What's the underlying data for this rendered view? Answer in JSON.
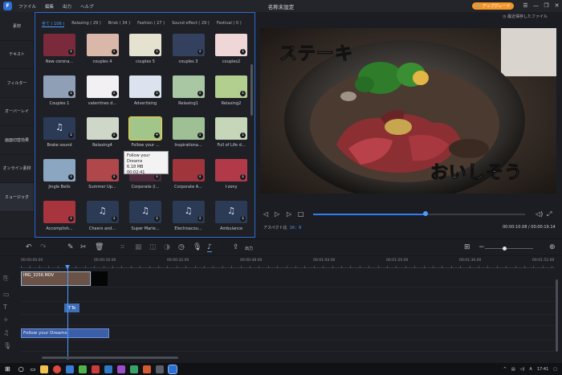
{
  "titlebar": {
    "menu": [
      "ファイル",
      "編集",
      "出力",
      "ヘルプ"
    ],
    "document_title": "名称未設定",
    "upgrade_label": "アップグレード"
  },
  "sidebar": {
    "items": [
      {
        "label": "素材"
      },
      {
        "label": "テキスト"
      },
      {
        "label": "フィルター"
      },
      {
        "label": "オーバーレイ"
      },
      {
        "label": "画面切替効果"
      },
      {
        "label": "オンライン素材"
      },
      {
        "label": "ミュージック"
      }
    ],
    "active_index": 6
  },
  "library": {
    "tabs": [
      {
        "label": "全て ( 106 )"
      },
      {
        "label": "Relaxing ( 29 )"
      },
      {
        "label": "Brisk ( 34 )"
      },
      {
        "label": "Fashion ( 27 )"
      },
      {
        "label": "Sound effect ( 29 )"
      },
      {
        "label": "Festival ( 0 )"
      }
    ],
    "items": [
      {
        "label": "New corona...",
        "color": "#7a2a3a",
        "icon": "image"
      },
      {
        "label": "couples 4",
        "color": "#d9b8a9",
        "icon": "image"
      },
      {
        "label": "couples 5",
        "color": "#e6e2d0",
        "icon": "image"
      },
      {
        "label": "couples 3",
        "color": "#33415e",
        "icon": "image"
      },
      {
        "label": "couples2",
        "color": "#f0d7d7",
        "icon": "image"
      },
      {
        "label": "Couples 1",
        "color": "#8f9fb6",
        "icon": "image"
      },
      {
        "label": "valentines d...",
        "color": "#f3f0f4",
        "icon": "image"
      },
      {
        "label": "Advertising",
        "color": "#dde3ee",
        "icon": "image"
      },
      {
        "label": "Relaxing1",
        "color": "#a9c7a3",
        "icon": "image"
      },
      {
        "label": "Relaxing2",
        "color": "#b3cf8f",
        "icon": "image"
      },
      {
        "label": "Brake sound",
        "color": "#2b3a55",
        "icon": "music-note"
      },
      {
        "label": "Relaxing4",
        "color": "#cfd8c8",
        "icon": "image"
      },
      {
        "label": "Follow your ...",
        "color": "#a2c58a",
        "icon": "image"
      },
      {
        "label": "Inspirationa...",
        "color": "#9fbf94",
        "icon": "image"
      },
      {
        "label": "Full of Life d...",
        "color": "#c6d6b9",
        "icon": "image"
      },
      {
        "label": "Jingle Bells",
        "color": "#8aa6c0",
        "icon": "image"
      },
      {
        "label": "Summer Up...",
        "color": "#b0474b",
        "icon": "image"
      },
      {
        "label": "Corporate (l...",
        "color": "#4e2a3e",
        "icon": "image"
      },
      {
        "label": "Corporate A...",
        "color": "#a0353c",
        "icon": "image"
      },
      {
        "label": "I-zony",
        "color": "#b23a48",
        "icon": "image"
      },
      {
        "label": "Accomplish...",
        "color": "#a8343d",
        "icon": "image"
      },
      {
        "label": "Cheers and...",
        "color": "#2b3a55",
        "icon": "music-note"
      },
      {
        "label": "Super Marie...",
        "color": "#2b3a55",
        "icon": "music-note"
      },
      {
        "label": "Electroacou...",
        "color": "#2b3a55",
        "icon": "music-note"
      },
      {
        "label": "Ambulance",
        "color": "#2b3a55",
        "icon": "music-note"
      }
    ],
    "selected_index": 12,
    "tooltip": {
      "title": "Follow your Dreams",
      "size": "6.18 MB",
      "duration": "00:02:41"
    }
  },
  "preview": {
    "saved_note": "最近保存したファイル",
    "caption_top": "ステーキ",
    "caption_bottom": "おいしそう",
    "aspect_label": "アスペクト比",
    "aspect_value": "16：9",
    "timecode": "00:00:10.08 / 00:00:19.14",
    "progress": 0.53
  },
  "toolbar": {
    "export_label": "出力"
  },
  "timeline": {
    "ruler_labels": [
      "00:00:00.00",
      "00:00:16.00",
      "00:00:32.00",
      "00:00:48.00",
      "00:01:04.00",
      "00:01:20.00",
      "00:01:36.00",
      "00:01:52.00"
    ],
    "video_clip_label": "IMG_3256.MOV",
    "text_clip_label": "Te",
    "audio_clip_label": "Follow your Dreams"
  },
  "taskbar": {
    "ime": "A",
    "clock": "17:41"
  }
}
